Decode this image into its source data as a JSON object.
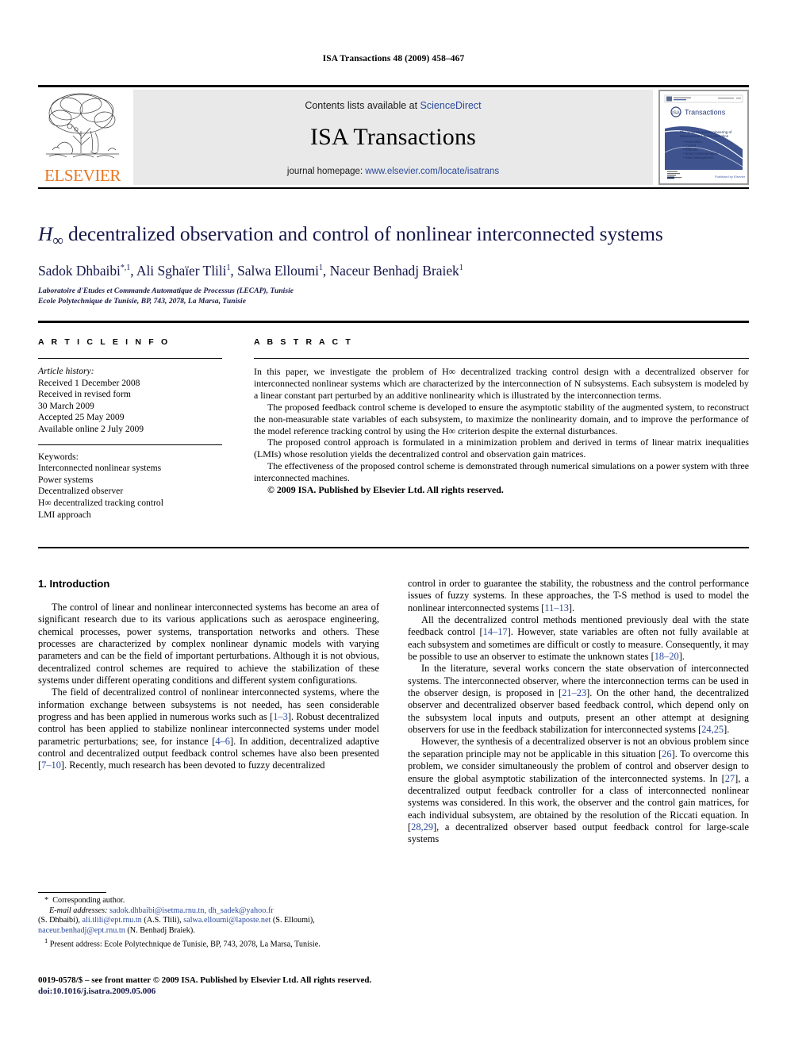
{
  "running_head": "ISA Transactions 48 (2009) 458–467",
  "masthead": {
    "publisher_logo_label": "ELSEVIER",
    "contents_line_prefix": "Contents lists available at ",
    "contents_link": "ScienceDirect",
    "journal_name": "ISA Transactions",
    "homepage_prefix": "journal homepage: ",
    "homepage_link": "www.elsevier.com/locate/isatrans",
    "cover_brand": "Transactions",
    "cover_tagline": "The Science and Engineering of Measurement and Automation",
    "cover_bullets": "• Automation  • Control  • Robotics  • Smart Instrumentation  • Asset Management",
    "link_color": "#2b4a9b",
    "panel_color": "#e9e9e9",
    "elsevier_orange": "#E87722"
  },
  "title": {
    "h_symbol": "H",
    "h_subscript": "∞",
    "rest": " decentralized observation and control of nonlinear interconnected systems",
    "color": "#17184B"
  },
  "authors": [
    {
      "name": "Sadok Dhbaibi",
      "marks": "*,1"
    },
    {
      "name": "Ali Sghaïer Tlili",
      "marks": "1"
    },
    {
      "name": "Salwa Elloumi",
      "marks": "1"
    },
    {
      "name": "Naceur Benhadj Braiek",
      "marks": "1"
    }
  ],
  "affiliations": [
    "Laboratoire d'Etudes et Commande Automatique de Processus (LECAP), Tunisie",
    "Ecole Polytechnique de Tunisie, BP, 743, 2078, La Marsa, Tunisie"
  ],
  "article_info": {
    "heading": "A R T I C L E    I N F O",
    "history_label": "Article history:",
    "history": [
      "Received 1 December 2008",
      "Received in revised form",
      "30 March 2009",
      "Accepted 25 May 2009",
      "Available online 2 July 2009"
    ],
    "keywords_label": "Keywords:",
    "keywords": [
      "Interconnected nonlinear systems",
      "Power systems",
      "Decentralized observer",
      "H∞ decentralized tracking control",
      "LMI approach"
    ]
  },
  "abstract": {
    "heading": "A B S T R A C T",
    "paragraphs": [
      "In this paper, we investigate the problem of H∞ decentralized tracking control design with a decentralized observer for interconnected nonlinear systems which are characterized by the interconnection of N subsystems. Each subsystem is modeled by a linear constant part perturbed by an additive nonlinearity which is illustrated by the interconnection terms.",
      "The proposed feedback control scheme is developed to ensure the asymptotic stability of the augmented system, to reconstruct the non-measurable state variables of each subsystem, to maximize the nonlinearity domain, and to improve the performance of the model reference tracking control by using the H∞ criterion despite the external disturbances.",
      "The proposed control approach is formulated in a minimization problem and derived in terms of linear matrix inequalities (LMIs) whose resolution yields the decentralized control and observation gain matrices.",
      "The effectiveness of the proposed control scheme is demonstrated through numerical simulations on a power system with three interconnected machines."
    ],
    "copyright": "© 2009 ISA. Published by Elsevier Ltd. All rights reserved."
  },
  "body": {
    "section_heading": "1. Introduction",
    "left_paragraphs": [
      "The control of linear and nonlinear interconnected systems has become an area of significant research due to its various applications such as aerospace engineering, chemical processes, power systems, transportation networks and others. These processes are characterized by complex nonlinear dynamic models with varying parameters and can be the field of important perturbations. Although it is not obvious, decentralized control schemes are required to achieve the stabilization of these systems under different operating conditions and different system configurations.",
      "The field of decentralized control of nonlinear interconnected systems, where the information exchange between subsystems is not needed, has seen considerable progress and has been applied in numerous works such as [1–3]. Robust decentralized control has been applied to stabilize nonlinear interconnected systems under model parametric perturbations; see, for instance [4–6]. In addition, decentralized adaptive control and decentralized output feedback control schemes have also been presented [7–10]. Recently, much research has been devoted to fuzzy decentralized"
    ],
    "right_paragraphs": [
      "control in order to guarantee the stability, the robustness and the control performance issues of fuzzy systems. In these approaches, the T-S method is used to model the nonlinear interconnected systems [11–13].",
      "All the decentralized control methods mentioned previously deal with the state feedback control [14–17]. However, state variables are often not fully available at each subsystem and sometimes are difficult or costly to measure. Consequently, it may be possible to use an observer to estimate the unknown states [18–20].",
      "In the literature, several works concern the state observation of interconnected systems. The interconnected observer, where the interconnection terms can be used in the observer design, is proposed in [21–23]. On the other hand, the decentralized observer and decentralized observer based feedback control, which depend only on the subsystem local inputs and outputs, present an other attempt at designing observers for use in the feedback stabilization for interconnected systems [24,25].",
      "However, the synthesis of a decentralized observer is not an obvious problem since the separation principle may not be applicable in this situation [26]. To overcome this problem, we consider simultaneously the problem of control and observer design to ensure the global asymptotic stabilization of the interconnected systems. In [27], a decentralized output feedback controller for a class of interconnected nonlinear systems was considered. In this work, the observer and the control gain matrices, for each individual subsystem, are obtained by the resolution of the Riccati equation. In [28,29], a decentralized observer based output feedback control for large-scale systems"
    ],
    "reference_color": "#2b4a9b"
  },
  "footnotes": {
    "corresponding": "Corresponding author.",
    "corresponding_mark": "*",
    "email_label": "E-mail addresses:",
    "email_text_1": " sadok.dhbaibi@isetma.rnu.tn, dh_sadek@yahoo.fr",
    "email_line_2_a": "(S. Dhbaibi), ",
    "email_line_2_b": "ali.tlili@ept.rnu.tn",
    "email_line_2_c": " (A.S. Tlili), ",
    "email_line_2_d": "salwa.elloumi@laposte.net",
    "email_line_2_e": " (S. Elloumi),",
    "email_line_3_a": "naceur.benhadj@ept.rnu.tn",
    "email_line_3_b": " (N. Benhadj Braiek).",
    "present_address_mark": "1",
    "present_address": "Present address: Ecole Polytechnique de Tunisie, BP, 743, 2078, La Marsa, Tunisie."
  },
  "imprint": {
    "line1": "0019-0578/$ – see front matter © 2009 ISA. Published by Elsevier Ltd. All rights reserved.",
    "doi": "doi:10.1016/j.isatra.2009.05.006"
  }
}
